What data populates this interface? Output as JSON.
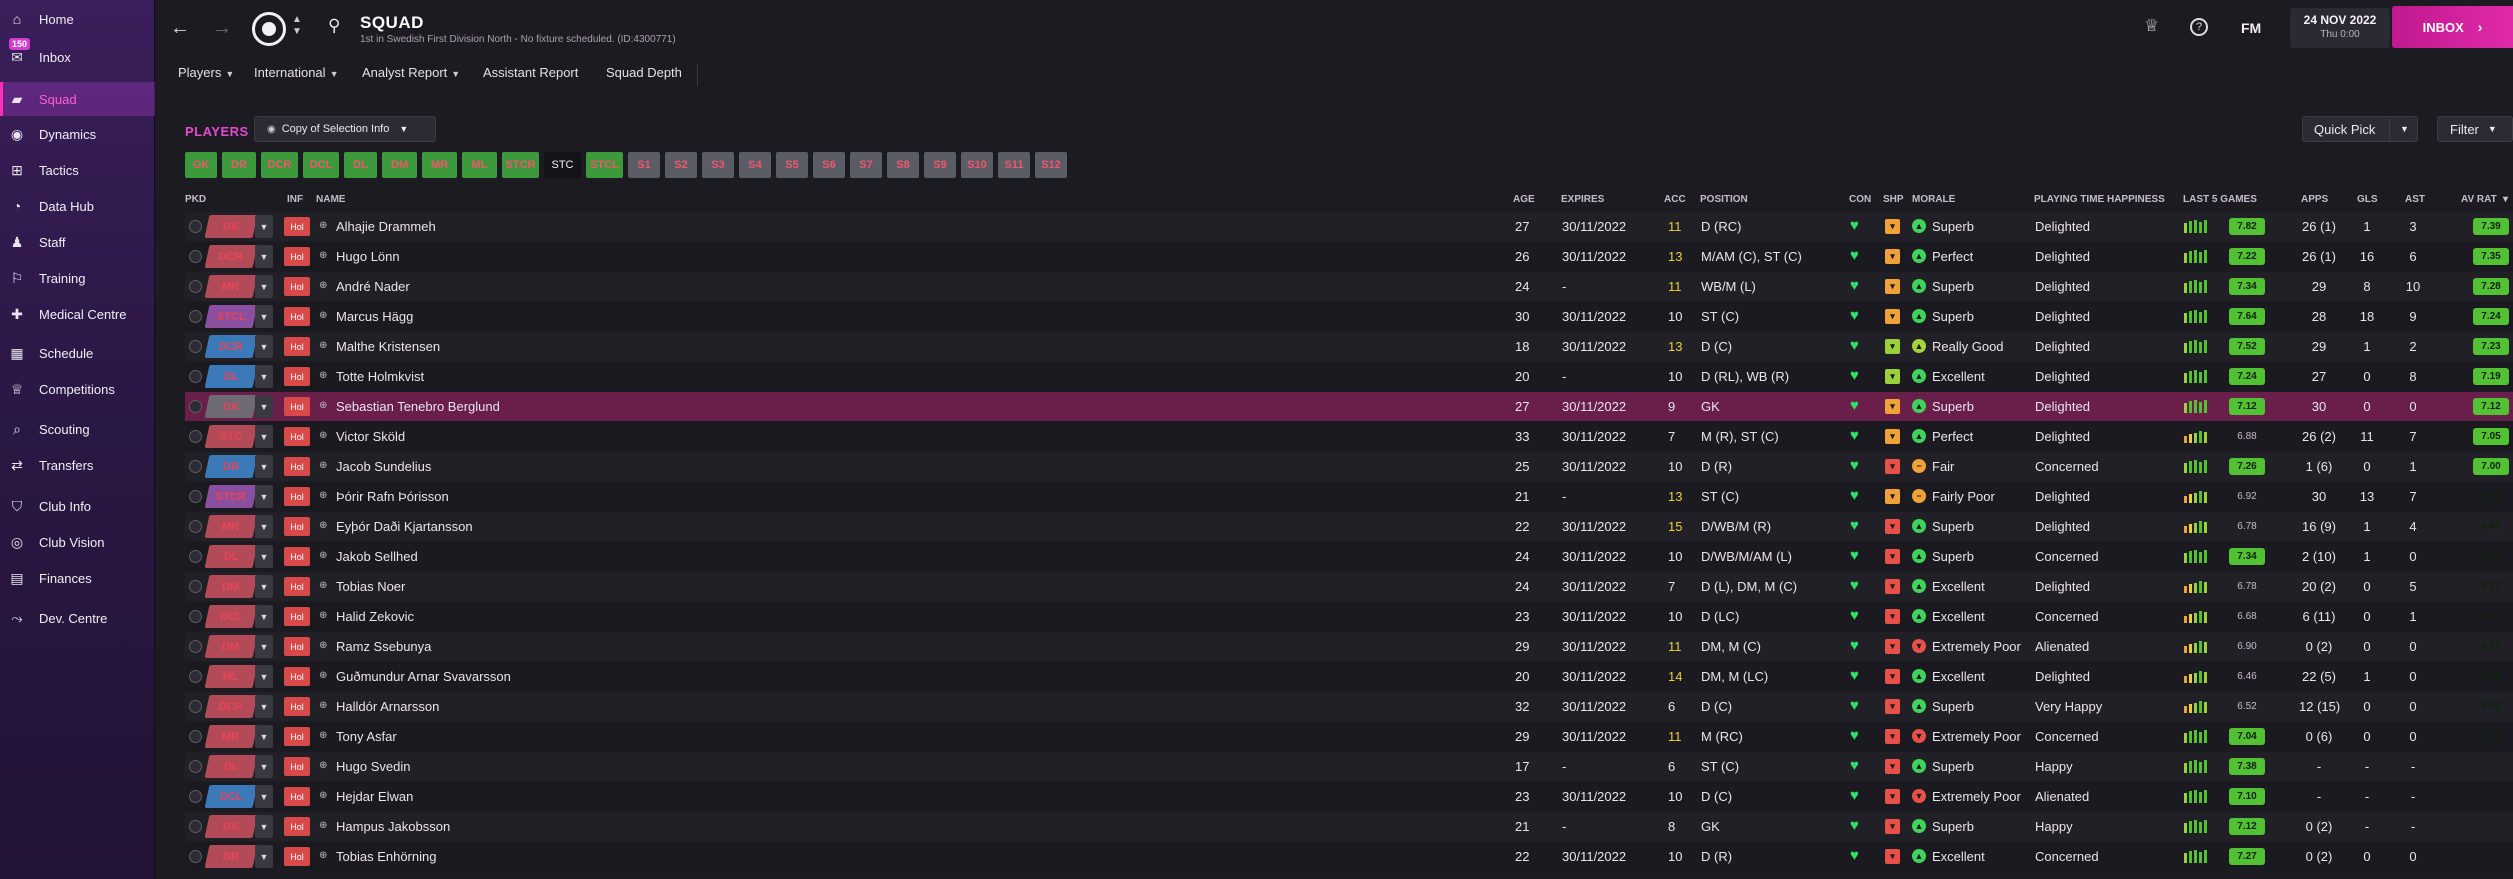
{
  "sidebar": {
    "items": [
      {
        "label": "Home",
        "icon": "home-icon",
        "glyph": "⌂"
      },
      {
        "label": "Inbox",
        "icon": "inbox-icon",
        "glyph": "✉",
        "badge": "150"
      },
      {
        "label": "Squad",
        "icon": "shirt-icon",
        "glyph": "▰",
        "active": true
      },
      {
        "label": "Dynamics",
        "icon": "dynamics-icon",
        "glyph": "◉"
      },
      {
        "label": "Tactics",
        "icon": "tactics-icon",
        "glyph": "⊞"
      },
      {
        "label": "Data Hub",
        "icon": "data-hub-icon",
        "glyph": "◔"
      },
      {
        "label": "Staff",
        "icon": "staff-icon",
        "glyph": "♟"
      },
      {
        "label": "Training",
        "icon": "training-icon",
        "glyph": "⚐"
      },
      {
        "label": "Medical Centre",
        "icon": "medical-icon",
        "glyph": "✚"
      },
      {
        "label": "Schedule",
        "icon": "calendar-icon",
        "glyph": "▦"
      },
      {
        "label": "Competitions",
        "icon": "trophy-icon",
        "glyph": "♕"
      },
      {
        "label": "Scouting",
        "icon": "scouting-icon",
        "glyph": "⌕"
      },
      {
        "label": "Transfers",
        "icon": "transfers-icon",
        "glyph": "⇄"
      },
      {
        "label": "Club Info",
        "icon": "shield-icon",
        "glyph": "⛉"
      },
      {
        "label": "Club Vision",
        "icon": "vision-icon",
        "glyph": "◎"
      },
      {
        "label": "Finances",
        "icon": "finances-icon",
        "glyph": "▤"
      },
      {
        "label": "Dev. Centre",
        "icon": "dev-centre-icon",
        "glyph": "⤳"
      }
    ]
  },
  "header": {
    "title": "SQUAD",
    "subtitle": "1st in Swedish First Division North - No fixture scheduled. (ID:4300771)",
    "date_main": "24 NOV 2022",
    "date_sub": "Thu 0:00",
    "fm_label": "FM",
    "inbox_label": "INBOX"
  },
  "subnav": [
    "Players",
    "International",
    "Analyst Report",
    "Assistant Report",
    "Squad Depth"
  ],
  "players_label": "PLAYERS",
  "view_dropdown": "Copy of Selection Info",
  "quick_pick": "Quick Pick",
  "filter": "Filter",
  "positions": [
    "GK",
    "DR",
    "DCR",
    "DCL",
    "DL",
    "DM",
    "MR",
    "ML",
    "STCR",
    "STC",
    "STCL",
    "S1",
    "S2",
    "S3",
    "S4",
    "S5",
    "S6",
    "S7",
    "S8",
    "S9",
    "S10",
    "S11",
    "S12"
  ],
  "columns": [
    "PKD",
    "INF",
    "NAME",
    "AGE",
    "EXPIRES",
    "ACC",
    "POSITION",
    "CON",
    "SHP",
    "MORALE",
    "PLAYING TIME HAPPINESS",
    "LAST 5 GAMES",
    "APPS",
    "GLS",
    "AST",
    "AV RAT"
  ],
  "inf_badge": "Hol",
  "players": [
    {
      "chip": "GK",
      "chip_color": "red",
      "name": "Alhajie Drammeh",
      "age": "27",
      "expires": "30/11/2022",
      "acc": "11",
      "acc_y": true,
      "position": "D (RC)",
      "shp": "orange",
      "morale": "Superb",
      "mor": "green",
      "ptime": "Delighted",
      "l5": "7.82",
      "apps": "26 (1)",
      "gls": "1",
      "ast": "3",
      "avr": "7.39",
      "avr_pill": true
    },
    {
      "chip": "DCR",
      "chip_color": "red",
      "name": "Hugo Lönn",
      "age": "26",
      "expires": "30/11/2022",
      "acc": "13",
      "acc_y": true,
      "position": "M/AM (C), ST (C)",
      "shp": "orange",
      "morale": "Perfect",
      "mor": "green",
      "ptime": "Delighted",
      "l5": "7.22",
      "apps": "26 (1)",
      "gls": "16",
      "ast": "6",
      "avr": "7.35",
      "avr_pill": true
    },
    {
      "chip": "MR",
      "chip_color": "red",
      "name": "André Nader",
      "age": "24",
      "expires": "-",
      "acc": "11",
      "acc_y": true,
      "position": "WB/M (L)",
      "shp": "orange",
      "morale": "Superb",
      "mor": "green",
      "ptime": "Delighted",
      "l5": "7.34",
      "apps": "29",
      "gls": "8",
      "ast": "10",
      "avr": "7.28",
      "avr_pill": true
    },
    {
      "chip": "STCL",
      "chip_color": "purple",
      "name": "Marcus Hägg",
      "age": "30",
      "expires": "30/11/2022",
      "acc": "10",
      "acc_y": false,
      "position": "ST (C)",
      "shp": "orange",
      "morale": "Superb",
      "mor": "green",
      "ptime": "Delighted",
      "l5": "7.64",
      "apps": "28",
      "gls": "18",
      "ast": "9",
      "avr": "7.24",
      "avr_pill": true
    },
    {
      "chip": "DCR",
      "chip_color": "blue",
      "name": "Malthe Kristensen",
      "age": "18",
      "expires": "30/11/2022",
      "acc": "13",
      "acc_y": true,
      "position": "D (C)",
      "shp": "green",
      "morale": "Really Good",
      "mor": "yg",
      "ptime": "Delighted",
      "l5": "7.52",
      "apps": "29",
      "gls": "1",
      "ast": "2",
      "avr": "7.23",
      "avr_pill": true
    },
    {
      "chip": "DL",
      "chip_color": "blue",
      "name": "Totte Holmkvist",
      "age": "20",
      "expires": "-",
      "acc": "10",
      "acc_y": false,
      "position": "D (RL), WB (R)",
      "shp": "green",
      "morale": "Excellent",
      "mor": "green",
      "ptime": "Delighted",
      "l5": "7.24",
      "apps": "27",
      "gls": "0",
      "ast": "8",
      "avr": "7.19",
      "avr_pill": true
    },
    {
      "chip": "GK",
      "chip_color": "grey",
      "name": "Sebastian Tenebro Berglund",
      "age": "27",
      "expires": "30/11/2022",
      "acc": "9",
      "acc_y": false,
      "position": "GK",
      "shp": "orange",
      "morale": "Superb",
      "mor": "green",
      "ptime": "Delighted",
      "l5": "7.12",
      "apps": "30",
      "gls": "0",
      "ast": "0",
      "avr": "7.12",
      "avr_pill": true,
      "selected": true
    },
    {
      "chip": "STC",
      "chip_color": "red",
      "name": "Victor Sköld",
      "age": "33",
      "expires": "30/11/2022",
      "acc": "7",
      "acc_y": false,
      "position": "M (R), ST (C)",
      "shp": "orange",
      "morale": "Perfect",
      "mor": "green",
      "ptime": "Delighted",
      "l5": "6.88",
      "apps": "26 (2)",
      "gls": "11",
      "ast": "7",
      "avr": "7.05",
      "avr_pill": true
    },
    {
      "chip": "DR",
      "chip_color": "blue",
      "name": "Jacob Sundelius",
      "age": "25",
      "expires": "30/11/2022",
      "acc": "10",
      "acc_y": false,
      "position": "D (R)",
      "shp": "red",
      "morale": "Fair",
      "mor": "orange",
      "ptime": "Concerned",
      "l5": "7.26",
      "apps": "1 (6)",
      "gls": "0",
      "ast": "1",
      "avr": "7.00",
      "avr_pill": true
    },
    {
      "chip": "STCR",
      "chip_color": "purple",
      "name": "Þórir Rafn Þórisson",
      "age": "21",
      "expires": "-",
      "acc": "13",
      "acc_y": true,
      "position": "ST (C)",
      "shp": "orange",
      "morale": "Fairly Poor",
      "mor": "orange",
      "ptime": "Delighted",
      "l5": "6.92",
      "apps": "30",
      "gls": "13",
      "ast": "7",
      "avr": "6.94",
      "avr_pill": false
    },
    {
      "chip": "MR",
      "chip_color": "red",
      "name": "Eyþór Daði Kjartansson",
      "age": "22",
      "expires": "30/11/2022",
      "acc": "15",
      "acc_y": true,
      "position": "D/WB/M (R)",
      "shp": "red",
      "morale": "Superb",
      "mor": "green",
      "ptime": "Delighted",
      "l5": "6.78",
      "apps": "16 (9)",
      "gls": "1",
      "ast": "4",
      "avr": "6.89",
      "avr_pill": false
    },
    {
      "chip": "DL",
      "chip_color": "red",
      "name": "Jakob Sellhed",
      "age": "24",
      "expires": "30/11/2022",
      "acc": "10",
      "acc_y": false,
      "position": "D/WB/M/AM (L)",
      "shp": "red",
      "morale": "Superb",
      "mor": "green",
      "ptime": "Concerned",
      "l5": "7.34",
      "apps": "2 (10)",
      "gls": "1",
      "ast": "0",
      "avr": "6.80",
      "avr_pill": false
    },
    {
      "chip": "DM",
      "chip_color": "red",
      "name": "Tobias Noer",
      "age": "24",
      "expires": "30/11/2022",
      "acc": "7",
      "acc_y": false,
      "position": "D (L), DM, M (C)",
      "shp": "red",
      "morale": "Excellent",
      "mor": "green",
      "ptime": "Delighted",
      "l5": "6.78",
      "apps": "20 (2)",
      "gls": "0",
      "ast": "5",
      "avr": "6.77",
      "avr_pill": false
    },
    {
      "chip": "DCL",
      "chip_color": "red",
      "name": "Halid Zekovic",
      "age": "23",
      "expires": "30/11/2022",
      "acc": "10",
      "acc_y": false,
      "position": "D (LC)",
      "shp": "red",
      "morale": "Excellent",
      "mor": "green",
      "ptime": "Concerned",
      "l5": "6.68",
      "apps": "6 (11)",
      "gls": "0",
      "ast": "1",
      "avr": "6.76",
      "avr_pill": false
    },
    {
      "chip": "DM",
      "chip_color": "red",
      "name": "Ramz Ssebunya",
      "age": "29",
      "expires": "30/11/2022",
      "acc": "11",
      "acc_y": true,
      "position": "DM, M (C)",
      "shp": "red",
      "morale": "Extremely Poor",
      "mor": "red",
      "ptime": "Alienated",
      "l5": "6.90",
      "apps": "0 (2)",
      "gls": "0",
      "ast": "0",
      "avr": "6.70",
      "avr_pill": false
    },
    {
      "chip": "ML",
      "chip_color": "red",
      "name": "Guðmundur Arnar Svavarsson",
      "age": "20",
      "expires": "30/11/2022",
      "acc": "14",
      "acc_y": true,
      "position": "DM, M (LC)",
      "shp": "red",
      "morale": "Excellent",
      "mor": "green",
      "ptime": "Delighted",
      "l5": "6.46",
      "apps": "22 (5)",
      "gls": "1",
      "ast": "0",
      "avr": "6.67",
      "avr_pill": false
    },
    {
      "chip": "DCR",
      "chip_color": "red",
      "name": "Halldór Arnarsson",
      "age": "32",
      "expires": "30/11/2022",
      "acc": "6",
      "acc_y": false,
      "position": "D (C)",
      "shp": "red",
      "morale": "Superb",
      "mor": "green",
      "ptime": "Very Happy",
      "l5": "6.52",
      "apps": "12 (15)",
      "gls": "0",
      "ast": "0",
      "avr": "6.53",
      "avr_pill": false
    },
    {
      "chip": "MR",
      "chip_color": "red",
      "name": "Tony Asfar",
      "age": "29",
      "expires": "30/11/2022",
      "acc": "11",
      "acc_y": true,
      "position": "M (RC)",
      "shp": "red",
      "morale": "Extremely Poor",
      "mor": "red",
      "ptime": "Concerned",
      "l5": "7.04",
      "apps": "0 (6)",
      "gls": "0",
      "ast": "0",
      "avr": "6.40",
      "avr_pill": false
    },
    {
      "chip": "DL",
      "chip_color": "red",
      "name": "Hugo Svedin",
      "age": "17",
      "expires": "-",
      "acc": "6",
      "acc_y": false,
      "position": "ST (C)",
      "shp": "red",
      "morale": "Superb",
      "mor": "green",
      "ptime": "Happy",
      "l5": "7.38",
      "apps": "-",
      "gls": "-",
      "ast": "-",
      "avr": "-",
      "avr_pill": false
    },
    {
      "chip": "DCL",
      "chip_color": "blue",
      "name": "Hejdar Elwan",
      "age": "23",
      "expires": "30/11/2022",
      "acc": "10",
      "acc_y": false,
      "position": "D (C)",
      "shp": "red",
      "morale": "Extremely Poor",
      "mor": "red",
      "ptime": "Alienated",
      "l5": "7.10",
      "apps": "-",
      "gls": "-",
      "ast": "-",
      "avr": "-",
      "avr_pill": false
    },
    {
      "chip": "GK",
      "chip_color": "red",
      "name": "Hampus Jakobsson",
      "age": "21",
      "expires": "-",
      "acc": "8",
      "acc_y": false,
      "position": "GK",
      "shp": "red",
      "morale": "Superb",
      "mor": "green",
      "ptime": "Happy",
      "l5": "7.12",
      "apps": "0 (2)",
      "gls": "-",
      "ast": "-",
      "avr": "-",
      "avr_pill": false
    },
    {
      "chip": "DR",
      "chip_color": "red",
      "name": "Tobias Enhörning",
      "age": "22",
      "expires": "30/11/2022",
      "acc": "10",
      "acc_y": false,
      "position": "D (R)",
      "shp": "red",
      "morale": "Excellent",
      "mor": "green",
      "ptime": "Concerned",
      "l5": "7.27",
      "apps": "0 (2)",
      "gls": "0",
      "ast": "0",
      "avr": "-",
      "avr_pill": false
    }
  ]
}
